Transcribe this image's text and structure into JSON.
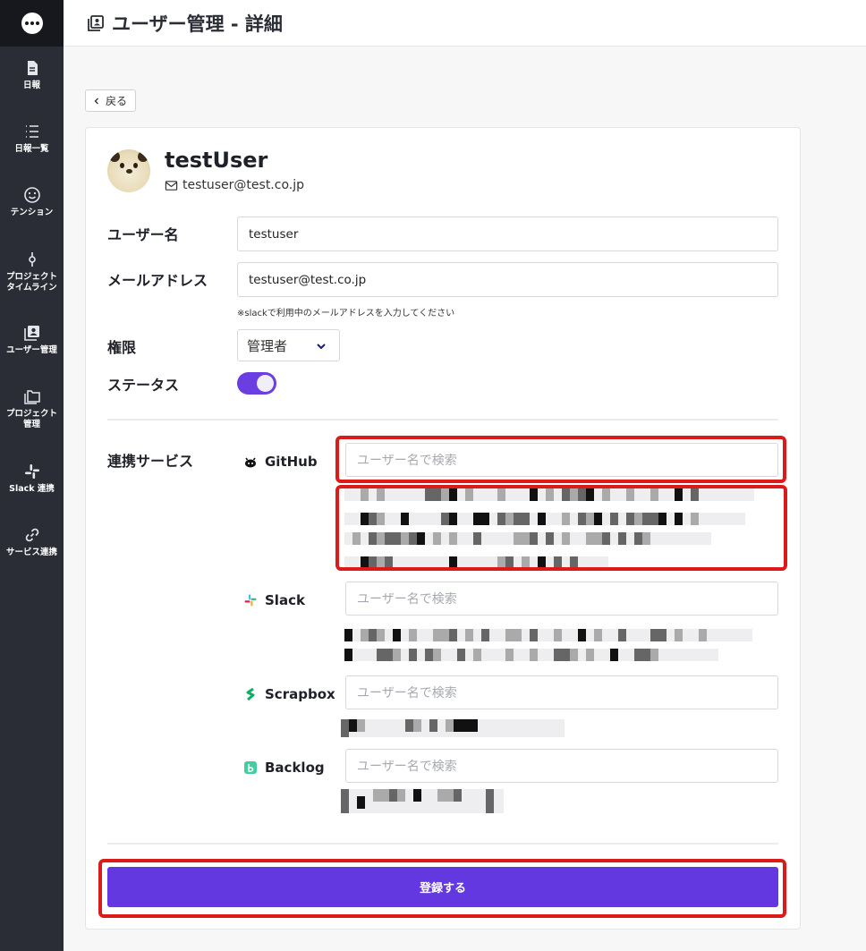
{
  "header": {
    "title": "ユーザー管理 - 詳細",
    "icon": "user-management-icon"
  },
  "sidebar": {
    "items": [
      {
        "label": "日報",
        "icon": "document-icon"
      },
      {
        "label": "日報一覧",
        "icon": "list-icon"
      },
      {
        "label": "テンション",
        "icon": "smiley-icon"
      },
      {
        "label": "プロジェクト\nタイムライン",
        "icon": "commit-icon"
      },
      {
        "label": "ユーザー管理",
        "icon": "user-management-icon"
      },
      {
        "label": "プロジェクト\n管理",
        "icon": "folders-icon"
      },
      {
        "label": "Slack 連携",
        "icon": "slack-icon"
      },
      {
        "label": "サービス連携",
        "icon": "link-icon"
      }
    ]
  },
  "back_button": {
    "label": "戻る"
  },
  "profile": {
    "name": "testUser",
    "email": "testuser@test.co.jp"
  },
  "form": {
    "username": {
      "label": "ユーザー名",
      "value": "testuser"
    },
    "email": {
      "label": "メールアドレス",
      "value": "testuser@test.co.jp",
      "hint": "※slackで利用中のメールアドレスを入力してください"
    },
    "role": {
      "label": "権限",
      "value": "管理者"
    },
    "status": {
      "label": "ステータス",
      "enabled": true
    }
  },
  "services": {
    "label": "連携サービス",
    "placeholder": "ユーザー名で検索",
    "items": [
      {
        "name": "GitHub",
        "icon": "github-icon"
      },
      {
        "name": "Slack",
        "icon": "slack-icon"
      },
      {
        "name": "Scrapbox",
        "icon": "scrapbox-icon"
      },
      {
        "name": "Backlog",
        "icon": "backlog-icon"
      }
    ]
  },
  "submit": {
    "label": "登録する"
  },
  "colors": {
    "accent": "#6438e0",
    "sidebar": "#2a2d35",
    "highlight": "#dd1a1a"
  }
}
